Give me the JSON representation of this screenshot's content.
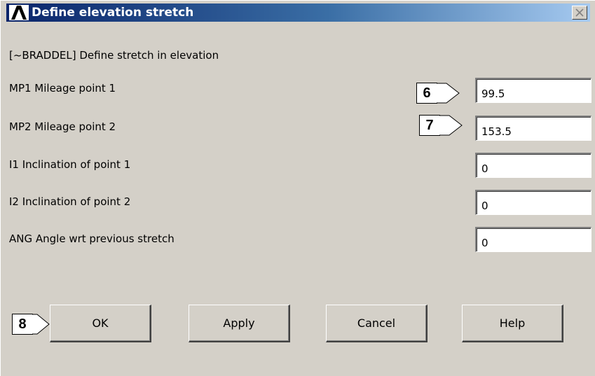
{
  "window": {
    "title": "Define elevation stretch",
    "logo_icon": "ansys-logo-icon",
    "close_icon": "close-icon"
  },
  "command_label": "[~BRADDEL] Define stretch in elevation",
  "fields": [
    {
      "label": "MP1 Mileage point 1",
      "value": "99.5"
    },
    {
      "label": "MP2 Mileage point 2",
      "value": "153.5"
    },
    {
      "label": "I1  Inclination of point 1",
      "value": "0"
    },
    {
      "label": "I2  Inclination of point 2",
      "value": "0"
    },
    {
      "label": "ANG Angle wrt previous stretch",
      "value": "0"
    }
  ],
  "buttons": {
    "ok": "OK",
    "apply": "Apply",
    "cancel": "Cancel",
    "help": "Help"
  },
  "callouts": {
    "mp1": "6",
    "mp2": "7",
    "ok": "8"
  },
  "colors": {
    "title_bar_start": "#0a246a",
    "title_bar_end": "#a6caf0",
    "dialog_background": "#d4d0c8"
  }
}
